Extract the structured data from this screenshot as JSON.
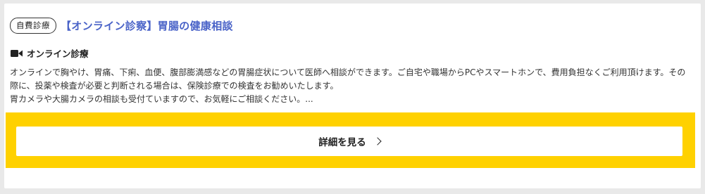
{
  "badge": "自費診療",
  "title": "【オンライン診察】胃腸の健康相談",
  "consult_type": {
    "icon": "video-camera-icon",
    "label": "オンライン診療"
  },
  "description": {
    "line1": "オンラインで胸やけ、胃痛、下痢、血便、腹部膨満感などの胃腸症状について医師へ相談ができます。ご自宅や職場からPCやスマートホンで、費用負担なくご利用頂けます。その際に、投薬や検査が必要と判断される場合は、保険診療での検査をお勧めいたします。",
    "line2": "胃カメラや大腸カメラの相談も受付ていますので、お気軽にご相談ください。..."
  },
  "cta": {
    "label": "詳細を見る",
    "icon": "chevron-right-icon"
  },
  "colors": {
    "title": "#4a63c8",
    "cta_band": "#ffd100"
  }
}
